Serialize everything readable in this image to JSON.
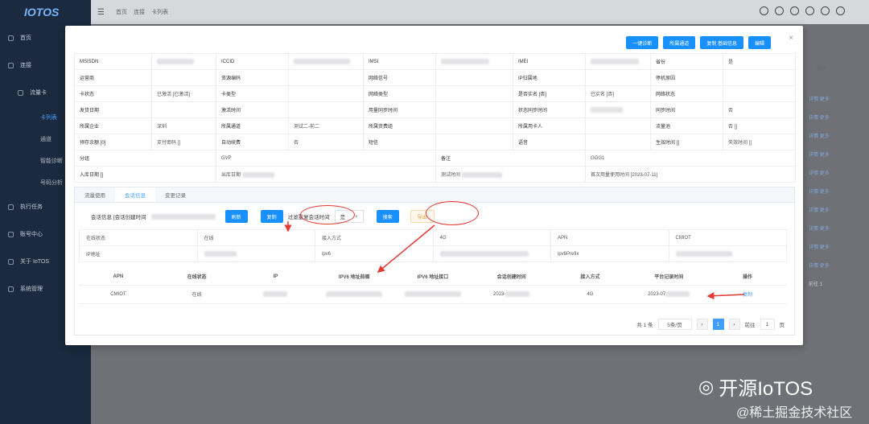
{
  "app": {
    "logo": "IOTOS"
  },
  "sidebar": {
    "items": [
      {
        "label": "首页"
      },
      {
        "label": "连接"
      },
      {
        "label": "流量卡"
      }
    ],
    "subitems": [
      {
        "label": "卡列表"
      },
      {
        "label": "通道"
      },
      {
        "label": "智能诊断"
      },
      {
        "label": "号码分析"
      }
    ],
    "items2": [
      {
        "label": "执行任务"
      },
      {
        "label": "账号中心"
      },
      {
        "label": "关于 IoTOS"
      },
      {
        "label": "系统管理"
      }
    ]
  },
  "topbar": {
    "crumbs": [
      "首页",
      "连接",
      "卡列表"
    ]
  },
  "background_ops": {
    "header": "操作",
    "link1": "详情",
    "link2": "更多",
    "page_label": "前往",
    "page_num": "1"
  },
  "modal": {
    "buttons": [
      "一键诊断",
      "所属通道",
      "复制 基础信息",
      "编辑"
    ],
    "close": "×"
  },
  "info": {
    "row1": [
      "MSISDN",
      "",
      "ICCID",
      "",
      "IMSI",
      "",
      "IMEI",
      "",
      "省份",
      "是"
    ],
    "row2": [
      "运营商",
      "",
      "资源编码",
      "",
      "网络信号",
      "",
      "IP归属地",
      "",
      "停机原因",
      ""
    ],
    "row3": [
      "卡状态",
      "已激活 [已激活]",
      "卡类型",
      "",
      "网络类型",
      "",
      "是否实名 [否]",
      "已实名 [否]",
      "网络状态",
      ""
    ],
    "row4": [
      "发货日期",
      "",
      "激活时间",
      "",
      "用量同步时间",
      "",
      "状态同步时间",
      "",
      "同步时间",
      "否"
    ],
    "row5": [
      "所属企业",
      "深圳",
      "所属通道",
      "测试二-前二",
      "所属资费组",
      "",
      "所属用卡人",
      "",
      "流量池",
      "否 []"
    ],
    "row6": [
      "预存余额 [0]",
      "支付密码 []",
      "自动续费",
      "否",
      "短信",
      "",
      "语音",
      "",
      "生效时间 []",
      "失效时间 []"
    ],
    "row7": [
      "分组",
      "GVP",
      "备注",
      "GGG1"
    ],
    "row8": [
      "入库日期 []",
      "出库日期",
      "测试时间",
      "首次用量使用时间 [2023-07-11]"
    ]
  },
  "tabs": [
    "流量使用",
    "会话信息",
    "变更记录"
  ],
  "session": {
    "label": "会话信息 [会话创建时间",
    "refresh": "刷新",
    "copy": "复制",
    "filter_label": "过滤重复会话时间",
    "filter_value": "是",
    "search": "搜索",
    "export": "导出"
  },
  "kv": {
    "row1": [
      "在线状态",
      "在线",
      "接入方式",
      "4G",
      "APN",
      "CMIOT"
    ],
    "row2": [
      "IP地址",
      "",
      "ipv6",
      "",
      "ipv6Prefix",
      ""
    ]
  },
  "list": {
    "headers": [
      "APN",
      "在线状态",
      "IP",
      "IPV6 地址前缀",
      "IPV6 地址接口",
      "会话创建时间",
      "接入方式",
      "平台记录时间",
      "操作"
    ],
    "rows": [
      [
        "CMIOT",
        "在线",
        "",
        "",
        "",
        "2023-",
        "4G",
        "2023-07",
        "复制"
      ]
    ]
  },
  "pager": {
    "total": "共 1 条",
    "size": "5条/页",
    "page": "1",
    "goto": "前往",
    "goto_val": "1",
    "unit": "页"
  },
  "watermark": {
    "brand": "开源IoTOS",
    "site": "@稀土掘金技术社区"
  }
}
